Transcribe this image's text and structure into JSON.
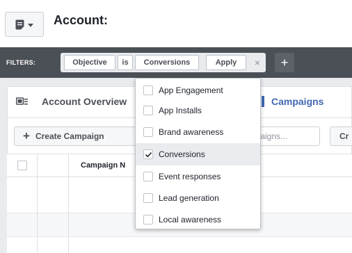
{
  "header": {
    "title": "Account:"
  },
  "filters": {
    "label": "FILTERS:",
    "field": "Objective",
    "operator": "is",
    "value": "Conversions",
    "apply_label": "Apply",
    "remove_symbol": "×",
    "add_symbol": "+"
  },
  "tabs": {
    "overview_label": "Account Overview",
    "campaigns_label": "Campaigns"
  },
  "toolbar": {
    "create_label": "Create Campaign",
    "create_symbol": "+",
    "search_placeholder": "ampaigns...",
    "cr_label": "Cr"
  },
  "table": {
    "columns": [
      "Campaign N"
    ]
  },
  "dropdown": {
    "options": [
      {
        "label": "App Engagement",
        "checked": false
      },
      {
        "label": "App Installs",
        "checked": false
      },
      {
        "label": "Brand awareness",
        "checked": false
      },
      {
        "label": "Conversions",
        "checked": true
      },
      {
        "label": "Event responses",
        "checked": false
      },
      {
        "label": "Lead generation",
        "checked": false
      },
      {
        "label": "Local awareness",
        "checked": false
      }
    ]
  },
  "icons": {
    "account_menu": "document-icon",
    "caret": "chevron-down-icon",
    "overview": "overview-icon",
    "check": "check-icon"
  },
  "colors": {
    "filter_bar": "#4b4f56",
    "accent": "#4267b2",
    "background": "#e9ebee"
  }
}
